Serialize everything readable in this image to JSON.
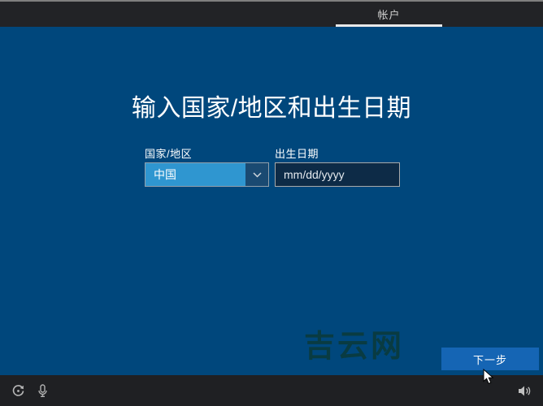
{
  "header": {
    "tab_label": "帐户"
  },
  "main": {
    "title": "输入国家/地区和出生日期",
    "form": {
      "country": {
        "label": "国家/地区",
        "value": "中国"
      },
      "birthdate": {
        "label": "出生日期",
        "placeholder": "mm/dd/yyyy"
      }
    },
    "watermark": "吉云网",
    "next_button_label": "下一步"
  },
  "footer": {
    "icons": [
      "ease-of-access-icon",
      "microphone-icon",
      "volume-icon"
    ]
  },
  "colors": {
    "background_blue": "#00477c",
    "topbar_dark": "#222326",
    "tab_underline": "#e9e9e9",
    "dropdown_blue": "#2f96d0",
    "dropdown_chevron_bg": "#1a4a72",
    "input_bg": "#0d2b47",
    "input_border": "#a9a9a9",
    "next_button_blue": "#1565b4",
    "watermark_teal": "#093b3f"
  }
}
